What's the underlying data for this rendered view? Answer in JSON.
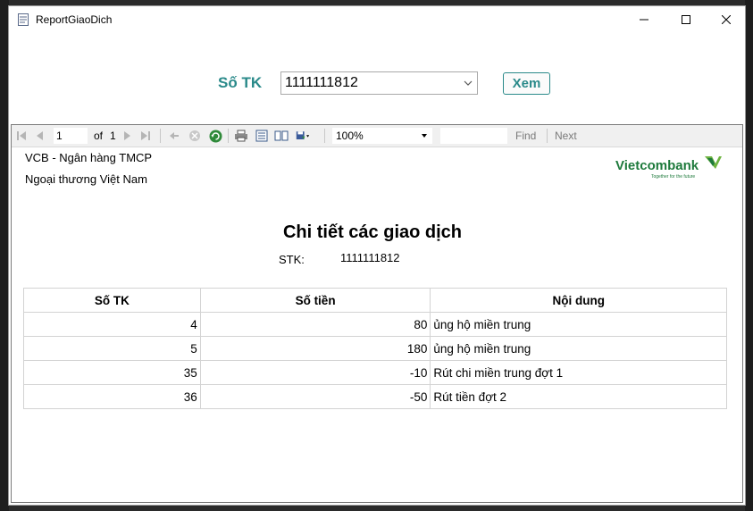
{
  "window": {
    "title": "ReportGiaoDich"
  },
  "form": {
    "account_label": "Số TK",
    "account_value": "1111111812",
    "view_button": "Xem"
  },
  "toolbar": {
    "current_page": "1",
    "of_label": "of",
    "total_pages": "1",
    "zoom": "100%",
    "find_label": "Find",
    "next_label": "Next"
  },
  "report": {
    "bank_name_line1": "VCB - Ngân hàng TMCP",
    "bank_name_line2": "Ngoại thương Việt Nam",
    "logo_text": "Vietcombank",
    "logo_tagline": "Together for the future",
    "title": "Chi tiết các giao dịch",
    "stk_label": "STK:",
    "stk_value": "1111111812",
    "columns": [
      "Số TK",
      "Số tiền",
      "Nội dung"
    ],
    "rows": [
      {
        "so_tk": "4",
        "so_tien": "80",
        "noi_dung": "ủng hộ miền trung"
      },
      {
        "so_tk": "5",
        "so_tien": "180",
        "noi_dung": "ủng hộ miền trung"
      },
      {
        "so_tk": "35",
        "so_tien": "-10",
        "noi_dung": "Rút chi miền trung đợt 1"
      },
      {
        "so_tk": "36",
        "so_tien": "-50",
        "noi_dung": "Rút tiền đợt 2"
      }
    ]
  },
  "colors": {
    "accent": "#2a8a8a",
    "logo_green": "#1e7a3c"
  }
}
